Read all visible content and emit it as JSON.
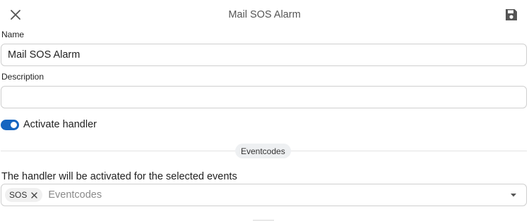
{
  "header": {
    "title": "Mail SOS Alarm",
    "close_icon": "close-icon",
    "save_icon": "save-icon"
  },
  "form": {
    "name_label": "Name",
    "name_value": "Mail SOS Alarm",
    "description_label": "Description",
    "description_value": "",
    "activate_label": "Activate handler",
    "activate_on": true
  },
  "eventcodes": {
    "divider_label": "Eventcodes",
    "helper_text": "The handler will be activated for the selected events",
    "selected": [
      "SOS"
    ],
    "placeholder": "Eventcodes"
  },
  "colors": {
    "accent": "#1565c0",
    "border": "#cfcfcf",
    "chip_bg": "#f0f0f0"
  }
}
